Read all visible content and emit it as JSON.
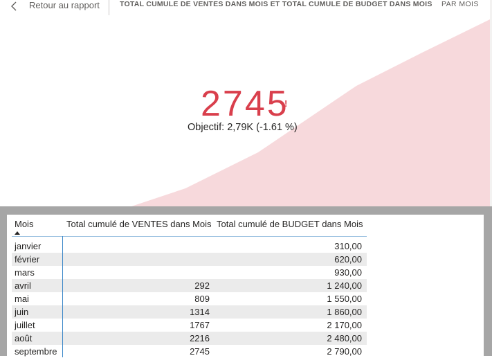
{
  "header": {
    "back_label": "Retour au rapport",
    "visual_title": "TOTAL CUMULE DE VENTES DANS MOIS ET TOTAL CUMULE DE BUDGET DANS MOIS",
    "period_tab": "PAR MOIS"
  },
  "kpi": {
    "value": "2745",
    "warning": "!",
    "goal_text": "Objectif: 2,79K (-1.61 %)",
    "value_color": "#d93f4c",
    "area_color": "#f7d9dc"
  },
  "table": {
    "headers": [
      "Mois",
      "Total cumulé de VENTES dans Mois",
      "Total cumulé de BUDGET dans Mois"
    ],
    "rows": [
      {
        "mois": "janvier",
        "ventes": "",
        "budget": "310,00"
      },
      {
        "mois": "février",
        "ventes": "",
        "budget": "620,00"
      },
      {
        "mois": "mars",
        "ventes": "",
        "budget": "930,00"
      },
      {
        "mois": "avril",
        "ventes": "292",
        "budget": "1 240,00"
      },
      {
        "mois": "mai",
        "ventes": "809",
        "budget": "1 550,00"
      },
      {
        "mois": "juin",
        "ventes": "1314",
        "budget": "1 860,00"
      },
      {
        "mois": "juillet",
        "ventes": "1767",
        "budget": "2 170,00"
      },
      {
        "mois": "août",
        "ventes": "2216",
        "budget": "2 480,00"
      },
      {
        "mois": "septembre",
        "ventes": "2745",
        "budget": "2 790,00"
      }
    ]
  }
}
